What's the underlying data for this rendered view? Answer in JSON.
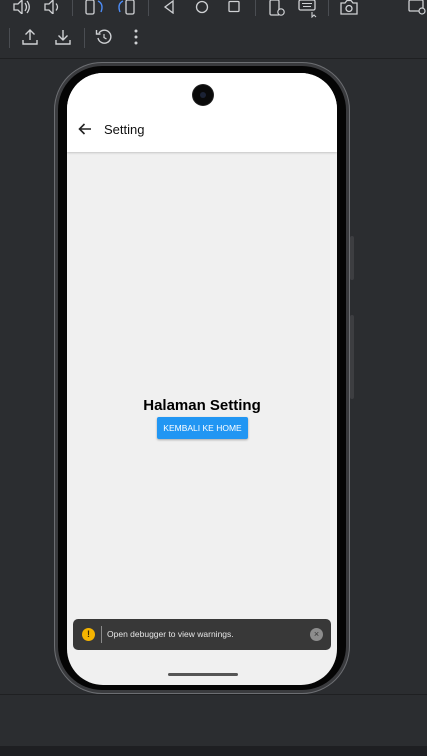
{
  "toolbar": {
    "icons": [
      "volume-up-icon",
      "volume-down-icon",
      "rotate-left-icon",
      "rotate-right-icon",
      "back-icon",
      "home-icon",
      "overview-icon",
      "fold-icon",
      "keyboard-icon",
      "camera-icon",
      "window-icon"
    ],
    "secondary_icons": [
      "upload-icon",
      "download-icon",
      "restore-icon",
      "more-vertical-icon"
    ]
  },
  "app": {
    "title": "Setting",
    "heading": "Halaman Setting",
    "button_label": "KEMBALI KE HOME",
    "accent_color": "#2196f3"
  },
  "toast": {
    "message": "Open debugger to view warnings.",
    "icon": "!",
    "close": "×"
  }
}
